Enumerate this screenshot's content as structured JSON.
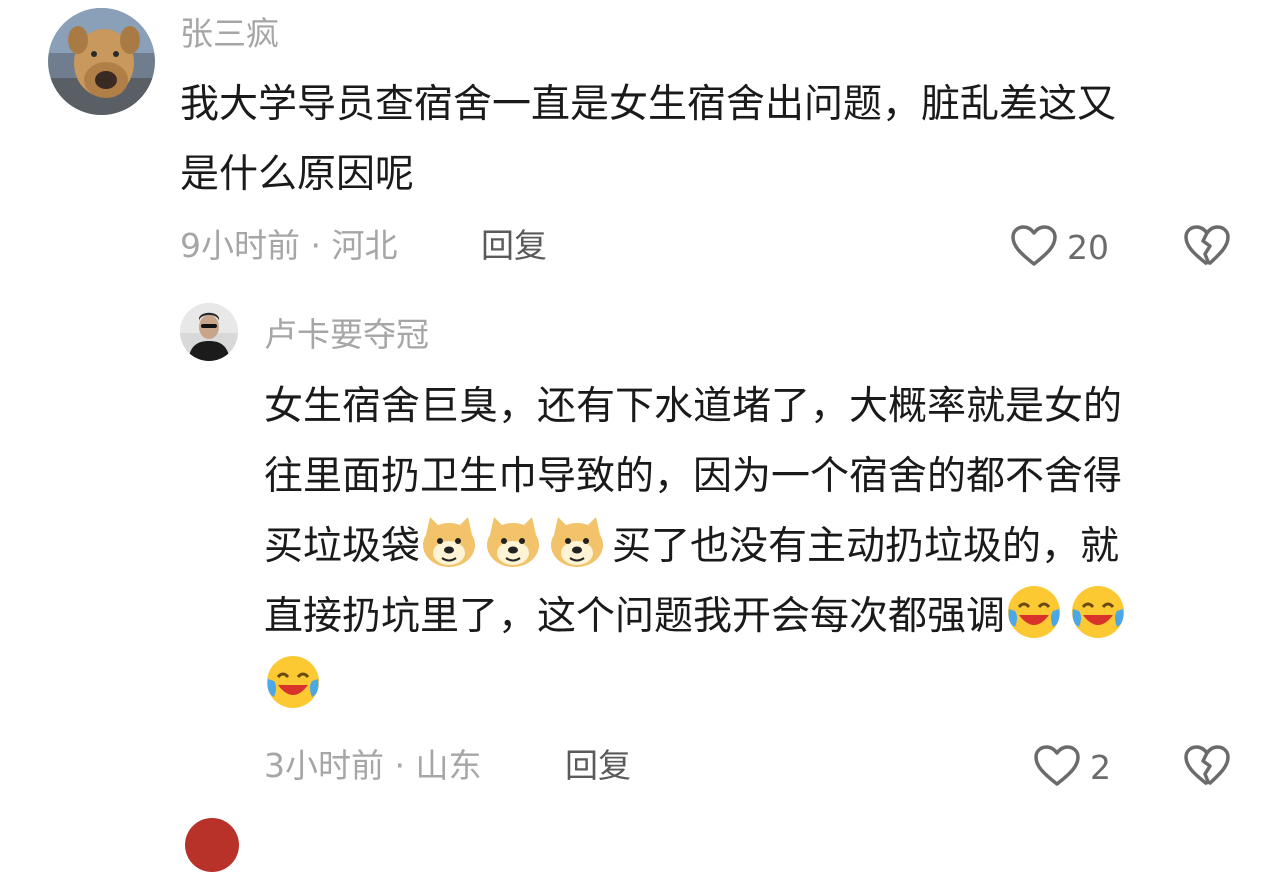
{
  "comment1": {
    "username": "张三疯",
    "lines": [
      "我大学导员查宿舍一直是女生宿舍出问题，脏乱差这又",
      "是什么原因呢"
    ],
    "time_location": "9小时前 · 河北",
    "reply_label": "回复",
    "likes": "20",
    "avatar_icon": "dog-photo-avatar"
  },
  "comment2": {
    "username": "卢卡要夺冠",
    "line1": "女生宿舍巨臭，还有下水道堵了，大概率就是女的",
    "line2": "往里面扔卫生巾导致的，因为一个宿舍的都不舍得",
    "line3_a": "买垃圾袋",
    "line3_b": "买了也没有主动扔垃圾的，就",
    "line4": "直接扔坑里了，这个问题我开会每次都强调",
    "time_location": "3小时前 · 山东",
    "reply_label": "回复",
    "likes": "2",
    "avatar_icon": "man-black-jacket-avatar"
  },
  "icons": {
    "like": "heart-outline-icon",
    "dislike": "broken-heart-icon",
    "emoji_doge": "doge-emoji",
    "emoji_laugh": "laugh-cry-emoji"
  },
  "colors": {
    "username": "#a6a6a6",
    "text": "#1a1a1a",
    "meta": "#a6a6a6",
    "reply": "#5a5a5a"
  }
}
